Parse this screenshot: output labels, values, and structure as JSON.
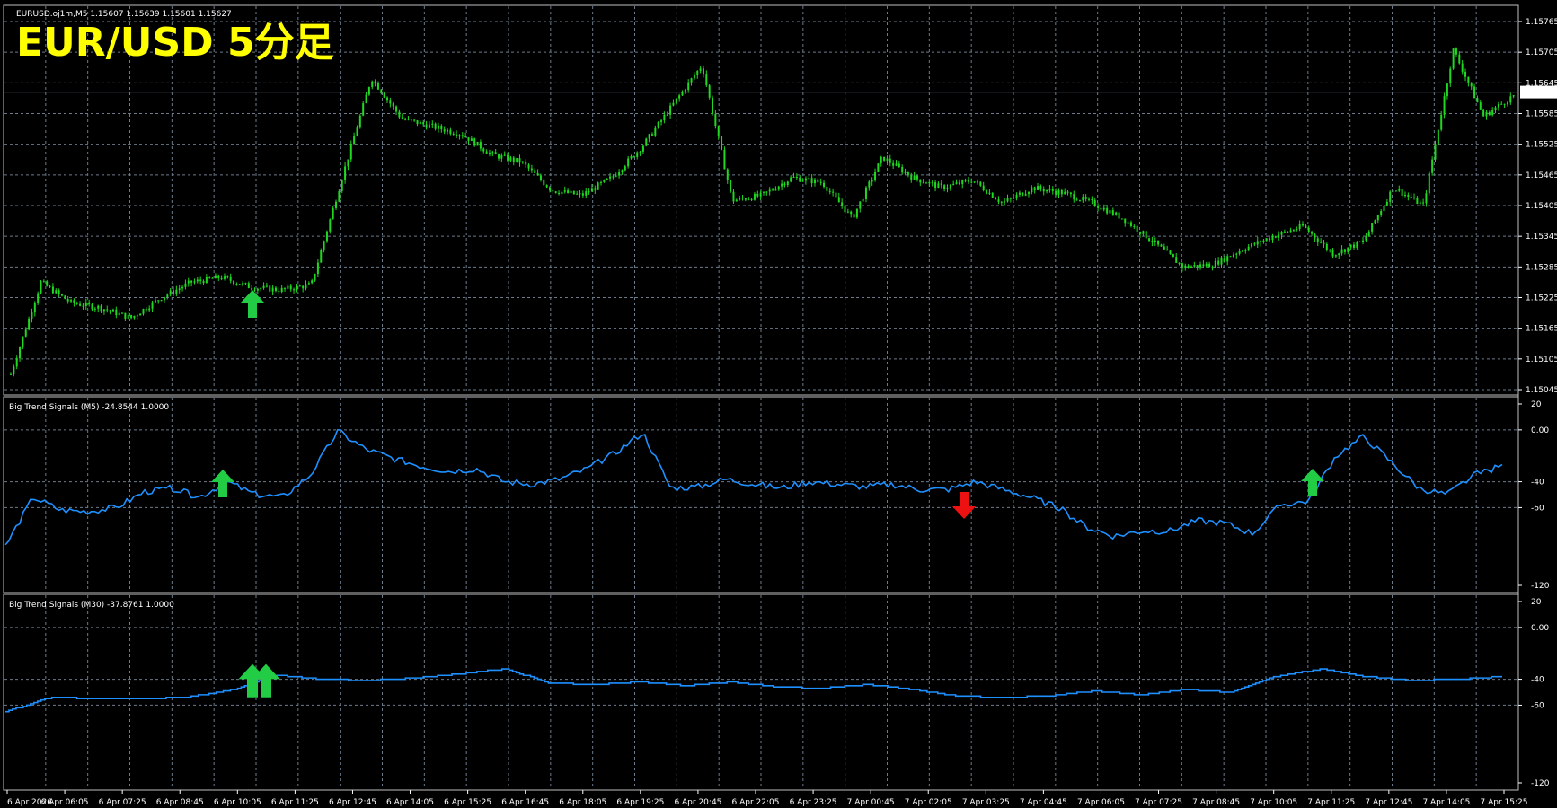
{
  "chart_title": "EUR/USD 5分足",
  "symbol_info": "EURUSD.oj1m,M5  1.15607 1.15639 1.15601 1.15627",
  "colors": {
    "background": "#000000",
    "grid": "#6b7b8c",
    "candles": "#1fd81f",
    "indicator_line": "#1e90ff",
    "up_arrow": "#22cc44",
    "down_arrow": "#ee1111",
    "bid_line": "#8fa7bf"
  },
  "chart_data": [
    {
      "type": "candlestick",
      "title": "EURUSD.oj1m,M5  1.15607 1.15639 1.15601 1.15627",
      "ylim": [
        1.15045,
        1.15765
      ],
      "y_ticks": [
        "1.15765",
        "1.15705",
        "1.15645",
        "1.15585",
        "1.15525",
        "1.15465",
        "1.15405",
        "1.15345",
        "1.15285",
        "1.15225",
        "1.15165",
        "1.15105",
        "1.15045"
      ],
      "current_price": "1.15627",
      "close_path": {
        "x_index": [
          0,
          1,
          2,
          3,
          4,
          5,
          6,
          7,
          8,
          9,
          10,
          11,
          12,
          13,
          14,
          15,
          16,
          17,
          18,
          19,
          20,
          21,
          22,
          23,
          24,
          25,
          26,
          27,
          28,
          29,
          30,
          31,
          32,
          33,
          34,
          35,
          36,
          37,
          38,
          39,
          40,
          41,
          42,
          43,
          44,
          45,
          46,
          47,
          48,
          49,
          50
        ],
        "close": [
          1.15075,
          1.15255,
          1.15215,
          1.15205,
          1.15185,
          1.15225,
          1.15255,
          1.15265,
          1.15245,
          1.1524,
          1.1525,
          1.15455,
          1.15655,
          1.15575,
          1.1556,
          1.15545,
          1.15505,
          1.1549,
          1.15435,
          1.15425,
          1.1546,
          1.1552,
          1.156,
          1.1568,
          1.15415,
          1.15425,
          1.1546,
          1.1545,
          1.1538,
          1.155,
          1.1546,
          1.1544,
          1.15455,
          1.1541,
          1.1544,
          1.1543,
          1.1541,
          1.1538,
          1.15335,
          1.15285,
          1.1529,
          1.1532,
          1.15345,
          1.15365,
          1.1531,
          1.15335,
          1.1544,
          1.15405,
          1.1571,
          1.1558,
          1.1562
        ]
      },
      "markers": [
        {
          "type": "up-arrow",
          "x_label": "6 Apr 09:45",
          "price": 1.15215
        }
      ]
    },
    {
      "type": "line",
      "title": "Big Trend Signals (M5) -24.8544 1.0000",
      "ylim": [
        -120,
        20
      ],
      "y_ticks": [
        "20",
        "0.00",
        "-40",
        "-60",
        "-120"
      ],
      "series": [
        {
          "values": [
            -90,
            -52,
            -62,
            -63,
            -60,
            -48,
            -45,
            -52,
            -40,
            -50,
            -52,
            -35,
            -1,
            -15,
            -22,
            -28,
            -32,
            -30,
            -40,
            -42,
            -38,
            -30,
            -18,
            -2,
            -45,
            -44,
            -38,
            -42,
            -45,
            -40,
            -42,
            -44,
            -42,
            -46,
            -46,
            -40,
            -46,
            -52,
            -60,
            -75,
            -82,
            -78,
            -78,
            -70,
            -72,
            -80,
            -58,
            -55,
            -20,
            -5,
            -25,
            -45,
            -50,
            -35,
            -28
          ]
        }
      ],
      "markers": [
        {
          "type": "up-arrow",
          "x_label": "6 Apr 09:45",
          "value": -52
        },
        {
          "type": "down-arrow",
          "x_label": "7 Apr 02:05",
          "value": -58
        },
        {
          "type": "up-arrow",
          "x_label": "7 Apr 10:05",
          "value": -47
        }
      ]
    },
    {
      "type": "line",
      "title": "Big Trend Signals (M30) -37.8761 1.0000",
      "ylim": [
        -120,
        20
      ],
      "y_ticks": [
        "20",
        "0.00",
        "-40",
        "-60",
        "-120"
      ],
      "series": [
        {
          "values": [
            -65,
            -54,
            -55,
            -55,
            -54,
            -48,
            -37,
            -40,
            -41,
            -39,
            -36,
            -32,
            -43,
            -44,
            -42,
            -45,
            -42,
            -46,
            -47,
            -44,
            -48,
            -53,
            -54,
            -53,
            -49,
            -52,
            -48,
            -50,
            -38,
            -32,
            -38,
            -41,
            -40,
            -38
          ]
        }
      ],
      "markers": [
        {
          "type": "up-arrow-double",
          "x_label": "6 Apr 10:05",
          "value": -45
        }
      ]
    }
  ],
  "x_axis": {
    "labels": [
      "6 Apr 2026",
      "6 Apr 06:05",
      "6 Apr 07:25",
      "6 Apr 08:45",
      "6 Apr 10:05",
      "6 Apr 11:25",
      "6 Apr 12:45",
      "6 Apr 14:05",
      "6 Apr 15:25",
      "6 Apr 16:45",
      "6 Apr 18:05",
      "6 Apr 19:25",
      "6 Apr 20:45",
      "6 Apr 22:05",
      "6 Apr 23:25",
      "7 Apr 00:45",
      "7 Apr 02:05",
      "7 Apr 03:25",
      "7 Apr 04:45",
      "7 Apr 06:05",
      "7 Apr 07:25",
      "7 Apr 08:45",
      "7 Apr 10:05",
      "7 Apr 11:25",
      "7 Apr 12:45",
      "7 Apr 14:05",
      "7 Apr 15:25"
    ]
  }
}
